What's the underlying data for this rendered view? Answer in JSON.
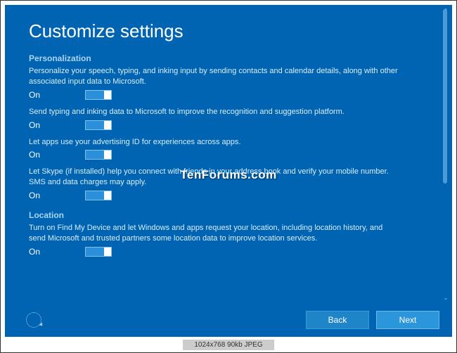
{
  "title": "Customize settings",
  "watermark": "TenForums.com",
  "caption": "1024x768  90kb  JPEG",
  "sections": {
    "personalization": {
      "header": "Personalization",
      "items": [
        {
          "desc": "Personalize your speech, typing, and inking input by sending contacts and calendar details, along with other associated input data to Microsoft.",
          "state": "On"
        },
        {
          "desc": "Send typing and inking data to Microsoft to improve the recognition and suggestion platform.",
          "state": "On"
        },
        {
          "desc": "Let apps use your advertising ID for experiences across apps.",
          "state": "On"
        },
        {
          "desc": "Let Skype (if installed) help you connect with friends in your address book and verify your mobile number. SMS and data charges may apply.",
          "state": "On"
        }
      ]
    },
    "location": {
      "header": "Location",
      "items": [
        {
          "desc": "Turn on Find My Device and let Windows and apps request your location, including location history, and send Microsoft and trusted partners some location data to improve location services.",
          "state": "On"
        }
      ]
    }
  },
  "buttons": {
    "back": "Back",
    "next": "Next"
  }
}
